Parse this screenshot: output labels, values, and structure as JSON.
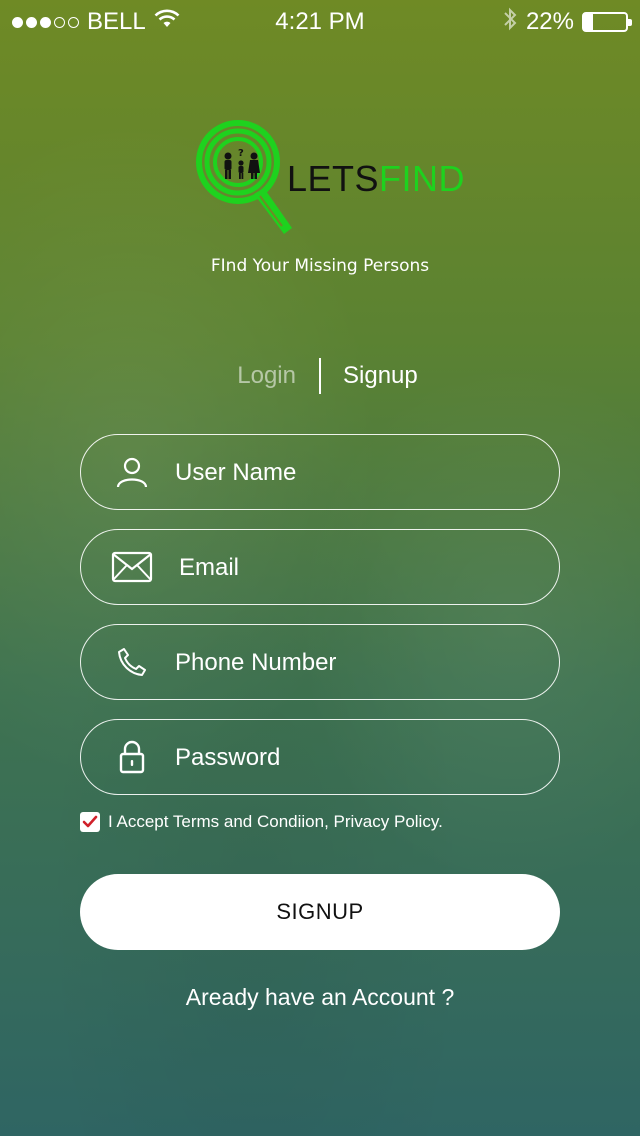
{
  "status_bar": {
    "carrier": "BELL",
    "time": "4:21 PM",
    "battery_percent": "22%",
    "battery_level": 0.22,
    "signal_dots_filled": 3,
    "signal_dots_total": 5,
    "icons": [
      "wifi-icon",
      "bluetooth-icon",
      "battery-icon"
    ]
  },
  "logo": {
    "text_dark": "LETS",
    "text_accent": "FIND",
    "accent_color": "#1ed21e"
  },
  "tagline": "FInd Your Missing Persons",
  "tabs": {
    "login": "Login",
    "signup": "Signup",
    "active": "signup"
  },
  "form": {
    "username_placeholder": "User Name",
    "email_placeholder": "Email",
    "phone_placeholder": "Phone Number",
    "password_placeholder": "Password",
    "icons": {
      "username": "user-icon",
      "email": "envelope-icon",
      "phone": "phone-icon",
      "password": "lock-icon"
    }
  },
  "terms": {
    "checked": true,
    "text": "I Accept Terms and Condiion, Privacy Policy.",
    "check_color": "#d0202a"
  },
  "signup_button": "SIGNUP",
  "have_account": "Aready have an Account ?"
}
